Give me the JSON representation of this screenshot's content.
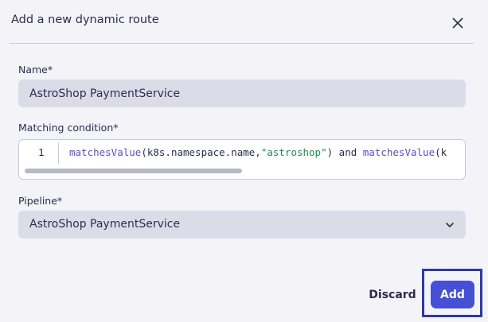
{
  "dialog": {
    "title": "Add a new dynamic route"
  },
  "form": {
    "name_label": "Name*",
    "name_value": "AstroShop PaymentService",
    "condition_label": "Matching condition*",
    "condition_line_number": "1",
    "condition_code": {
      "fn1": "matchesValue",
      "arg1": "(k8s.namespace.name,",
      "str1": "\"astroshop\"",
      "rest": ") and ",
      "fn2": "matchesValue",
      "tail": "(k"
    },
    "pipeline_label": "Pipeline*",
    "pipeline_value": "AstroShop PaymentService"
  },
  "footer": {
    "discard_label": "Discard",
    "add_label": "Add"
  },
  "colors": {
    "accent": "#4550d4",
    "highlight": "#2a3aa8",
    "background": "#f3f3f8",
    "input_bg": "#dcdce8"
  },
  "icons": {
    "close": "close-icon",
    "dropdown": "chevron-down-icon"
  }
}
